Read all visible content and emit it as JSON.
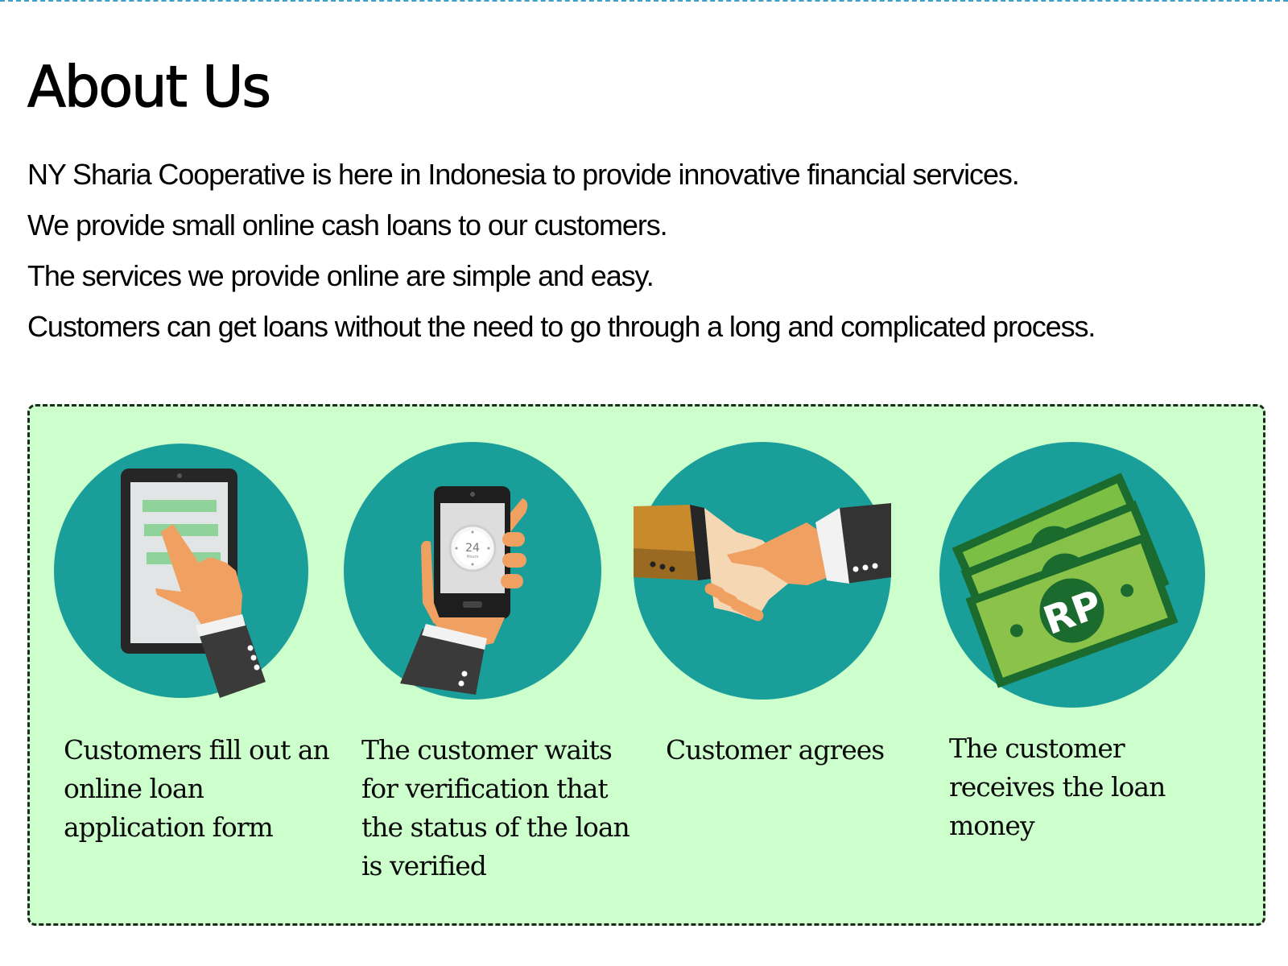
{
  "page": {
    "title": "About Us",
    "intro": [
      "NY Sharia Cooperative is here in Indonesia to provide innovative financial services.",
      "We provide small online cash loans to our customers.",
      "The services we provide online are simple and easy.",
      "Customers can get loans without the need to go through a long and complicated process."
    ]
  },
  "steps": [
    {
      "icon": "tablet-form-icon",
      "label": "Customers fill out an online loan application form"
    },
    {
      "icon": "phone-24-hours-icon",
      "label": "The customer waits for verification that the status of the loan is verified",
      "clock_number": "24",
      "clock_caption": "Hours"
    },
    {
      "icon": "handshake-icon",
      "label": "Customer agrees"
    },
    {
      "icon": "banknotes-icon",
      "label": "The customer receives the loan money",
      "currency_mark": "RP"
    }
  ],
  "colors": {
    "circle": "#1a9e9a",
    "panel_bg": "#ccffcc",
    "panel_border": "#1e2a1e",
    "skin": "#f0a060",
    "sleeve": "#3a3a3a",
    "money_green": "#8bc34a"
  }
}
